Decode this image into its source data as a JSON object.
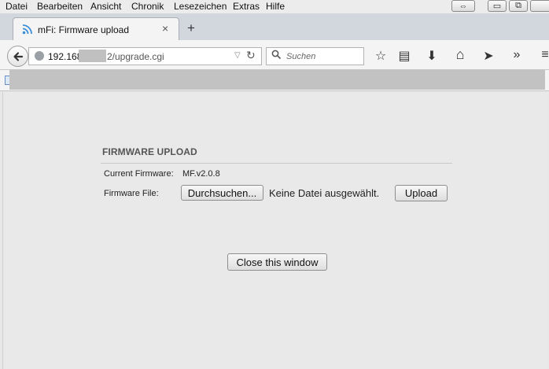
{
  "menu": {
    "items": [
      "Datei",
      "Bearbeiten",
      "Ansicht",
      "Chronik",
      "Lesezeichen",
      "Extras",
      "Hilfe"
    ]
  },
  "window_controls": {
    "minimize_glyph": "▭",
    "restore_glyph": "⧉",
    "resize_glyph": "⇔"
  },
  "tab": {
    "title": "mFi: Firmware upload",
    "close_glyph": "×",
    "new_tab_glyph": "+"
  },
  "address_bar": {
    "host": "192.168",
    "path": "2/upgrade.cgi",
    "search_placeholder": "Suchen"
  },
  "toolbar": {
    "icons": [
      "star-icon",
      "reading-list-icon",
      "download-icon",
      "home-icon",
      "send-icon",
      "overflow-icon",
      "menu-icon"
    ],
    "glyphs": [
      "☆",
      "▤",
      "⬇",
      "⌂",
      "➤",
      "»",
      "≡"
    ]
  },
  "page": {
    "heading": "FIRMWARE UPLOAD",
    "current_firmware_label": "Current Firmware:",
    "current_firmware_value": "MF.v2.0.8",
    "firmware_file_label": "Firmware File:",
    "browse_button": "Durchsuchen...",
    "no_file_text": "Keine Datei ausgewählt.",
    "upload_button": "Upload",
    "close_button": "Close this window"
  },
  "colors": {
    "tab_strip": "#d2d7de",
    "content_bg": "#e9e9e9",
    "rss_icon": "#3b8fd9"
  }
}
